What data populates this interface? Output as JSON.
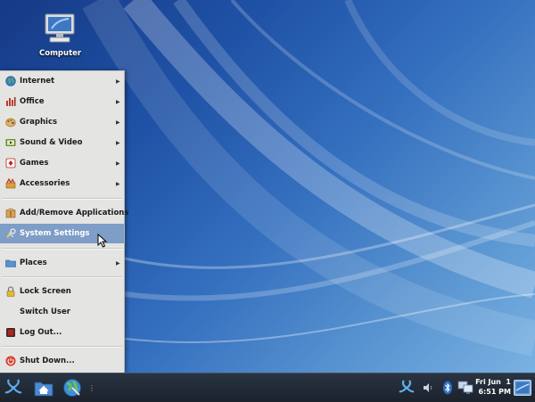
{
  "desktop": {
    "icons": [
      {
        "label": "Computer",
        "icon": "computer-icon"
      }
    ]
  },
  "menu": {
    "items": [
      {
        "label": "Internet",
        "icon": "globe-icon",
        "submenu": true
      },
      {
        "label": "Office",
        "icon": "office-icon",
        "submenu": true
      },
      {
        "label": "Graphics",
        "icon": "graphics-icon",
        "submenu": true
      },
      {
        "label": "Sound & Video",
        "icon": "media-icon",
        "submenu": true
      },
      {
        "label": "Games",
        "icon": "games-icon",
        "submenu": true
      },
      {
        "label": "Accessories",
        "icon": "accessories-icon",
        "submenu": true
      },
      {
        "label": "Add/Remove Applications",
        "icon": "package-icon",
        "submenu": false
      },
      {
        "label": "System Settings",
        "icon": "settings-icon",
        "submenu": false,
        "highlighted": true
      },
      {
        "label": "Places",
        "icon": "folder-icon",
        "submenu": true
      },
      {
        "label": "Lock Screen",
        "icon": "lock-icon",
        "submenu": false
      },
      {
        "label": "Switch User",
        "icon": "",
        "submenu": false
      },
      {
        "label": "Log Out...",
        "icon": "logout-icon",
        "submenu": false
      },
      {
        "label": "Shut Down...",
        "icon": "power-icon",
        "submenu": false
      }
    ],
    "highlight_color": "#7e9dc7"
  },
  "taskbar": {
    "start_icon": "distro-logo-icon",
    "launchers": [
      "home-folder-icon",
      "browser-icon"
    ],
    "tray": [
      "update-icon",
      "volume-icon",
      "bluetooth-icon",
      "network-icon"
    ],
    "clock": {
      "day": "Fri Jun  1",
      "time": "6:51 PM"
    },
    "show_desktop_icon": "show-desktop-icon"
  }
}
